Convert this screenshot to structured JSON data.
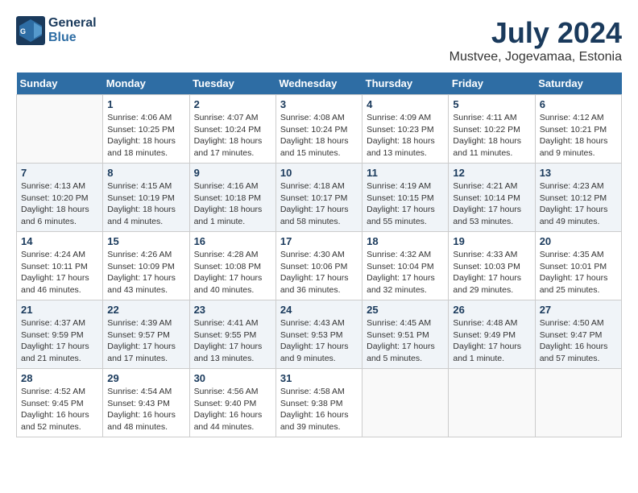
{
  "header": {
    "logo_line1": "General",
    "logo_line2": "Blue",
    "month": "July 2024",
    "location": "Mustvee, Jogevamaa, Estonia"
  },
  "weekdays": [
    "Sunday",
    "Monday",
    "Tuesday",
    "Wednesday",
    "Thursday",
    "Friday",
    "Saturday"
  ],
  "weeks": [
    [
      {
        "day": "",
        "content": ""
      },
      {
        "day": "1",
        "content": "Sunrise: 4:06 AM\nSunset: 10:25 PM\nDaylight: 18 hours\nand 18 minutes."
      },
      {
        "day": "2",
        "content": "Sunrise: 4:07 AM\nSunset: 10:24 PM\nDaylight: 18 hours\nand 17 minutes."
      },
      {
        "day": "3",
        "content": "Sunrise: 4:08 AM\nSunset: 10:24 PM\nDaylight: 18 hours\nand 15 minutes."
      },
      {
        "day": "4",
        "content": "Sunrise: 4:09 AM\nSunset: 10:23 PM\nDaylight: 18 hours\nand 13 minutes."
      },
      {
        "day": "5",
        "content": "Sunrise: 4:11 AM\nSunset: 10:22 PM\nDaylight: 18 hours\nand 11 minutes."
      },
      {
        "day": "6",
        "content": "Sunrise: 4:12 AM\nSunset: 10:21 PM\nDaylight: 18 hours\nand 9 minutes."
      }
    ],
    [
      {
        "day": "7",
        "content": "Sunrise: 4:13 AM\nSunset: 10:20 PM\nDaylight: 18 hours\nand 6 minutes."
      },
      {
        "day": "8",
        "content": "Sunrise: 4:15 AM\nSunset: 10:19 PM\nDaylight: 18 hours\nand 4 minutes."
      },
      {
        "day": "9",
        "content": "Sunrise: 4:16 AM\nSunset: 10:18 PM\nDaylight: 18 hours\nand 1 minute."
      },
      {
        "day": "10",
        "content": "Sunrise: 4:18 AM\nSunset: 10:17 PM\nDaylight: 17 hours\nand 58 minutes."
      },
      {
        "day": "11",
        "content": "Sunrise: 4:19 AM\nSunset: 10:15 PM\nDaylight: 17 hours\nand 55 minutes."
      },
      {
        "day": "12",
        "content": "Sunrise: 4:21 AM\nSunset: 10:14 PM\nDaylight: 17 hours\nand 53 minutes."
      },
      {
        "day": "13",
        "content": "Sunrise: 4:23 AM\nSunset: 10:12 PM\nDaylight: 17 hours\nand 49 minutes."
      }
    ],
    [
      {
        "day": "14",
        "content": "Sunrise: 4:24 AM\nSunset: 10:11 PM\nDaylight: 17 hours\nand 46 minutes."
      },
      {
        "day": "15",
        "content": "Sunrise: 4:26 AM\nSunset: 10:09 PM\nDaylight: 17 hours\nand 43 minutes."
      },
      {
        "day": "16",
        "content": "Sunrise: 4:28 AM\nSunset: 10:08 PM\nDaylight: 17 hours\nand 40 minutes."
      },
      {
        "day": "17",
        "content": "Sunrise: 4:30 AM\nSunset: 10:06 PM\nDaylight: 17 hours\nand 36 minutes."
      },
      {
        "day": "18",
        "content": "Sunrise: 4:32 AM\nSunset: 10:04 PM\nDaylight: 17 hours\nand 32 minutes."
      },
      {
        "day": "19",
        "content": "Sunrise: 4:33 AM\nSunset: 10:03 PM\nDaylight: 17 hours\nand 29 minutes."
      },
      {
        "day": "20",
        "content": "Sunrise: 4:35 AM\nSunset: 10:01 PM\nDaylight: 17 hours\nand 25 minutes."
      }
    ],
    [
      {
        "day": "21",
        "content": "Sunrise: 4:37 AM\nSunset: 9:59 PM\nDaylight: 17 hours\nand 21 minutes."
      },
      {
        "day": "22",
        "content": "Sunrise: 4:39 AM\nSunset: 9:57 PM\nDaylight: 17 hours\nand 17 minutes."
      },
      {
        "day": "23",
        "content": "Sunrise: 4:41 AM\nSunset: 9:55 PM\nDaylight: 17 hours\nand 13 minutes."
      },
      {
        "day": "24",
        "content": "Sunrise: 4:43 AM\nSunset: 9:53 PM\nDaylight: 17 hours\nand 9 minutes."
      },
      {
        "day": "25",
        "content": "Sunrise: 4:45 AM\nSunset: 9:51 PM\nDaylight: 17 hours\nand 5 minutes."
      },
      {
        "day": "26",
        "content": "Sunrise: 4:48 AM\nSunset: 9:49 PM\nDaylight: 17 hours\nand 1 minute."
      },
      {
        "day": "27",
        "content": "Sunrise: 4:50 AM\nSunset: 9:47 PM\nDaylight: 16 hours\nand 57 minutes."
      }
    ],
    [
      {
        "day": "28",
        "content": "Sunrise: 4:52 AM\nSunset: 9:45 PM\nDaylight: 16 hours\nand 52 minutes."
      },
      {
        "day": "29",
        "content": "Sunrise: 4:54 AM\nSunset: 9:43 PM\nDaylight: 16 hours\nand 48 minutes."
      },
      {
        "day": "30",
        "content": "Sunrise: 4:56 AM\nSunset: 9:40 PM\nDaylight: 16 hours\nand 44 minutes."
      },
      {
        "day": "31",
        "content": "Sunrise: 4:58 AM\nSunset: 9:38 PM\nDaylight: 16 hours\nand 39 minutes."
      },
      {
        "day": "",
        "content": ""
      },
      {
        "day": "",
        "content": ""
      },
      {
        "day": "",
        "content": ""
      }
    ]
  ]
}
